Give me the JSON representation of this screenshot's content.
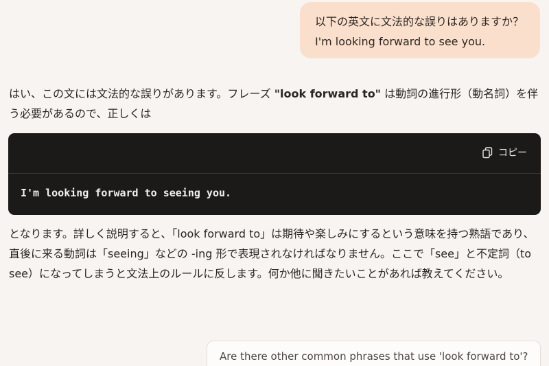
{
  "user_message": {
    "line1": "以下の英文に文法的な誤りはありますか？",
    "line2": "I'm looking forward to see you."
  },
  "answer": {
    "intro_before": "はい、この文には文法的な誤りがあります。フレーズ ",
    "intro_phrase": "\"look forward to\"",
    "intro_after": " は動詞の進行形（動名詞）を伴う必要があるので、正しくは",
    "body": "となります。詳しく説明すると、「look forward to」は期待や楽しみにするという意味を持つ熟語であり、直後に来る動詞は「seeing」などの -ing 形で表現されなければなりません。ここで「see」と不定詞（to see）になってしまうと文法上のルールに反します。何か他に聞きたいことがあれば教えてください。"
  },
  "code_block": {
    "copy_label": "コピー",
    "copy_icon": "copy-icon",
    "code": "I'm looking forward to seeing you."
  },
  "suggestion": {
    "text": "Are there other common phrases that use 'look forward to'?"
  },
  "colors": {
    "background": "#f7f4f1",
    "user_bubble": "#fadfcc",
    "code_background": "#1b1a19"
  }
}
